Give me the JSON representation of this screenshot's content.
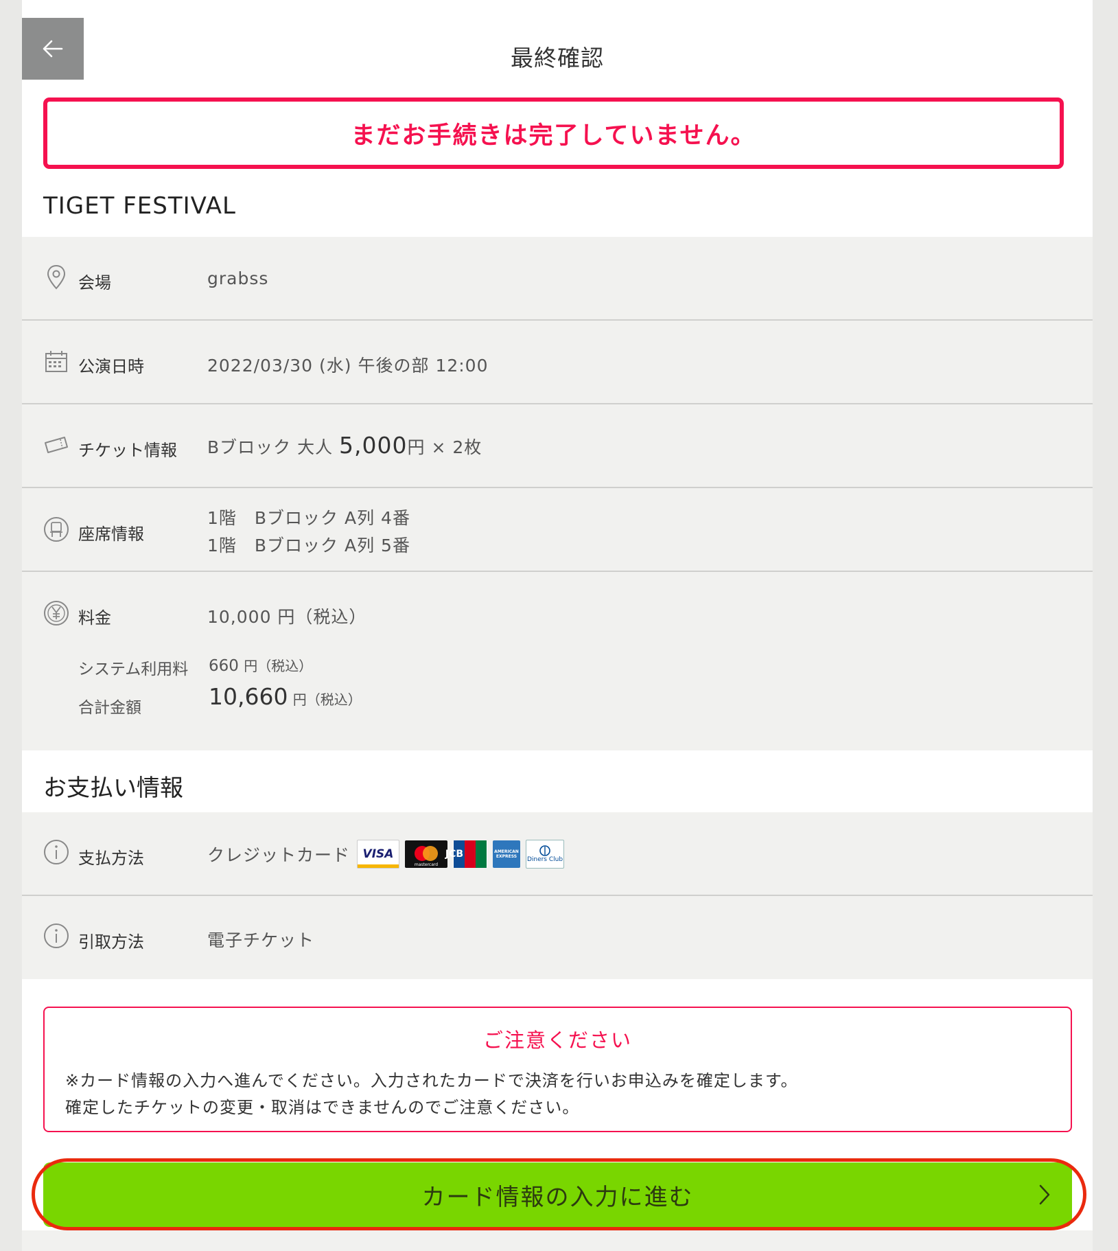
{
  "header": {
    "title": "最終確認",
    "back_icon": "arrow-left-icon"
  },
  "alert": {
    "message": "まだお手続きは完了していません。",
    "color": "#f5114f"
  },
  "event": {
    "title": "TIGET FESTIVAL"
  },
  "details": {
    "venue": {
      "label": "会場",
      "value": "grabss",
      "icon": "map-pin-icon"
    },
    "datetime": {
      "label": "公演日時",
      "value": "2022/03/30 (水) 午後の部 12:00",
      "icon": "calendar-icon"
    },
    "ticket": {
      "label": "チケット情報",
      "prefix": "Bブロック 大人 ",
      "price": "5,000",
      "yen": "円",
      "qty": " × 2枚",
      "icon": "ticket-icon"
    },
    "seat": {
      "label": "座席情報",
      "seats": [
        "1階　Bブロック A列 4番",
        "1階　Bブロック A列 5番"
      ],
      "icon": "seat-icon"
    },
    "fee": {
      "label": "料金",
      "value": "10,000 円（税込）",
      "icon": "yen-icon",
      "system_label": "システム利用料",
      "system_amount": "660",
      "system_unit": "円（税込）",
      "total_label": "合計金額",
      "total_amount": "10,660",
      "total_unit": "円（税込）"
    }
  },
  "payment": {
    "section_title": "お支払い情報",
    "method": {
      "label": "支払方法",
      "value": "クレジットカード",
      "icon": "info-icon"
    },
    "cards": [
      "VISA",
      "mastercard",
      "JCB",
      "AMERICAN EXPRESS",
      "Diners Club"
    ],
    "pickup": {
      "label": "引取方法",
      "value": "電子チケット",
      "icon": "info-icon"
    }
  },
  "notice": {
    "title": "ご注意ください",
    "line1": "※カード情報の入力へ進んでください。入力されたカードで決済を行いお申込みを確定します。",
    "line2": "確定したチケットの変更・取消はできませんのでご注意ください。"
  },
  "cta": {
    "label": "カード情報の入力に進む",
    "color": "#79d600",
    "chevron_icon": "chevron-right-icon"
  }
}
